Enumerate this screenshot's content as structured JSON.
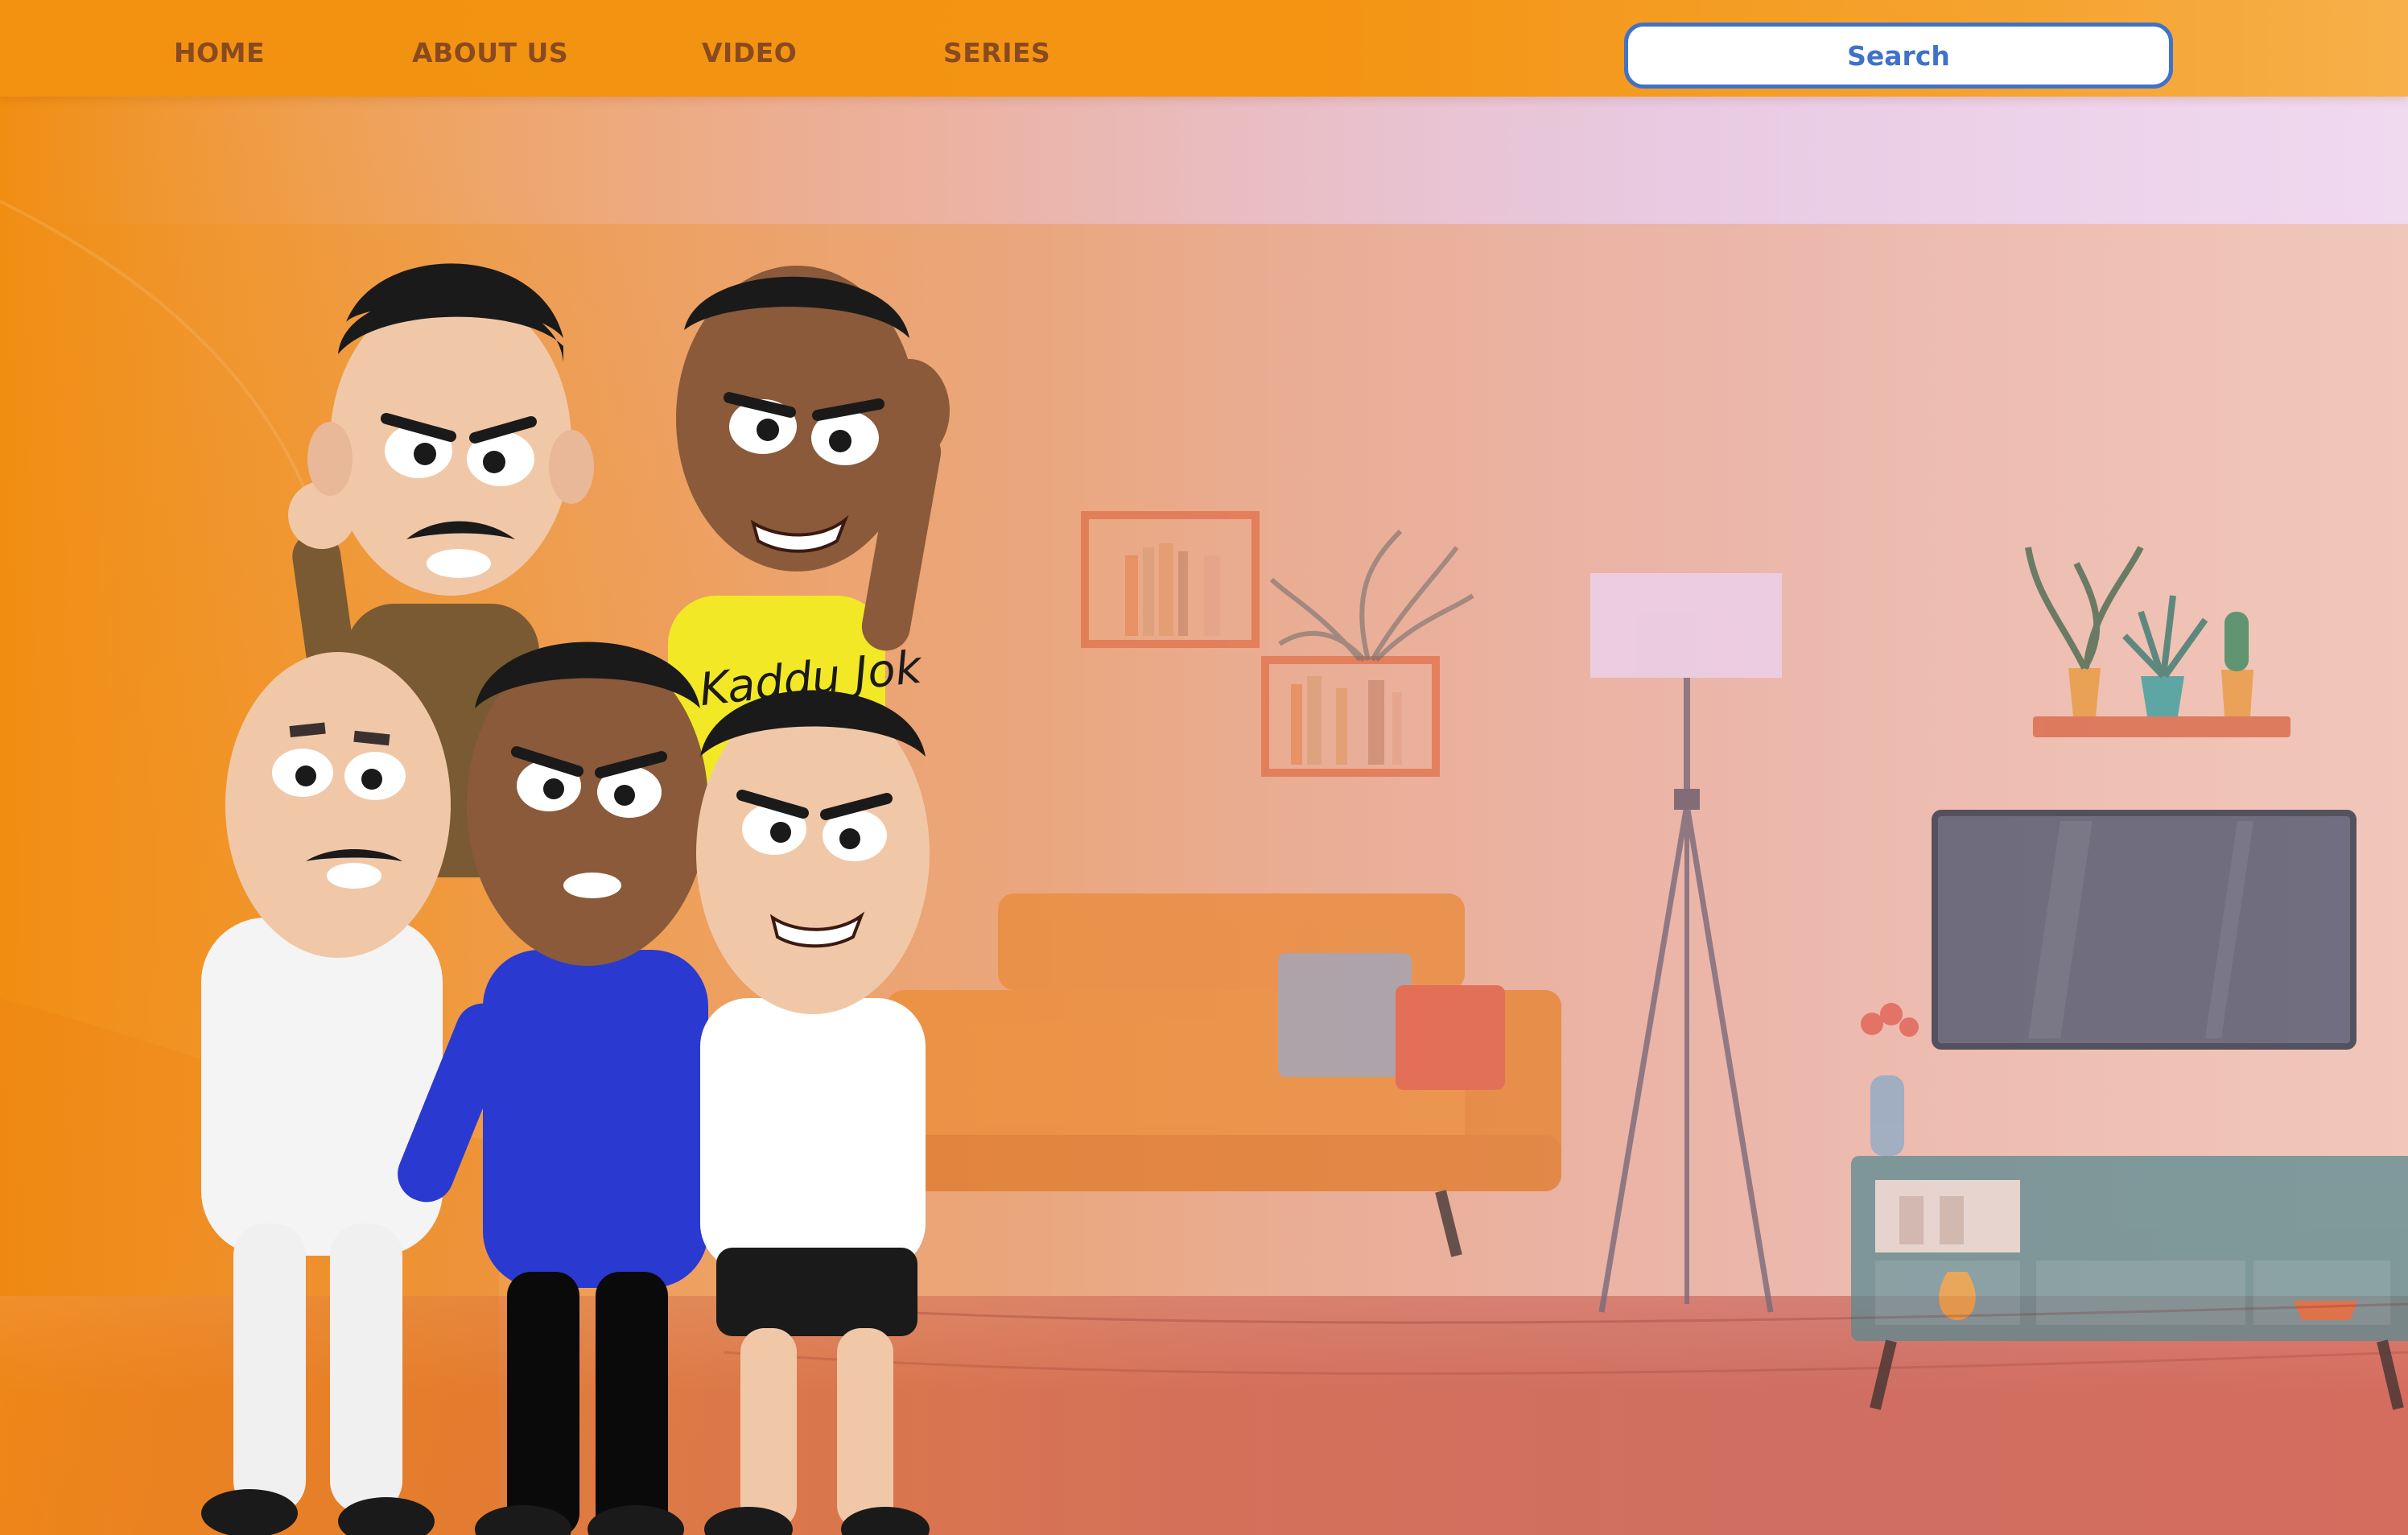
{
  "nav": {
    "home_label": "HOME",
    "about_label": "ABOUT US",
    "video_label": "VIDEO",
    "series_label": "SERIES"
  },
  "search": {
    "placeholder": "Search"
  },
  "hero": {
    "shirt_print": "Kaddu Jok"
  },
  "colors": {
    "header_orange": "#f29210",
    "nav_text": "#8a4a20",
    "search_accent": "#3f72c8",
    "hero_wall": "#e9b0a0",
    "hero_floor": "#d4705a"
  }
}
